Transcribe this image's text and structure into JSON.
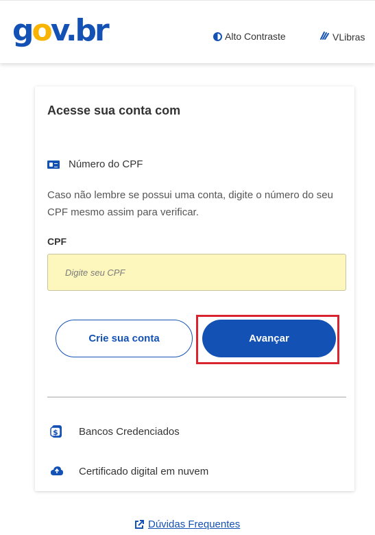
{
  "header": {
    "logo": {
      "g": "g",
      "o1": "o",
      "v": "v",
      "dot": ".",
      "b": "b",
      "r": "r"
    },
    "contrast_label": "Alto Contraste",
    "vlibras_label": "VLibras"
  },
  "card": {
    "title": "Acesse sua conta com",
    "cpf_option_label": "Número do CPF",
    "help_text": "Caso não lembre se possui uma conta, digite o número do seu CPF mesmo assim para verificar.",
    "cpf_label": "CPF",
    "cpf_placeholder": "Digite seu CPF",
    "cpf_value": "",
    "create_account_label": "Crie sua conta",
    "next_label": "Avançar",
    "options": [
      {
        "label": "Bancos Credenciados",
        "icon": "bank-icon"
      },
      {
        "label": "Certificado digital em nuvem",
        "icon": "cloud-icon"
      }
    ]
  },
  "footer": {
    "faq_label": "Dúvidas Frequentes"
  },
  "colors": {
    "primary": "#1351b4",
    "input_bg": "#fdf7bd",
    "highlight": "#d9232e",
    "logo_yellow": "#f8b400"
  }
}
